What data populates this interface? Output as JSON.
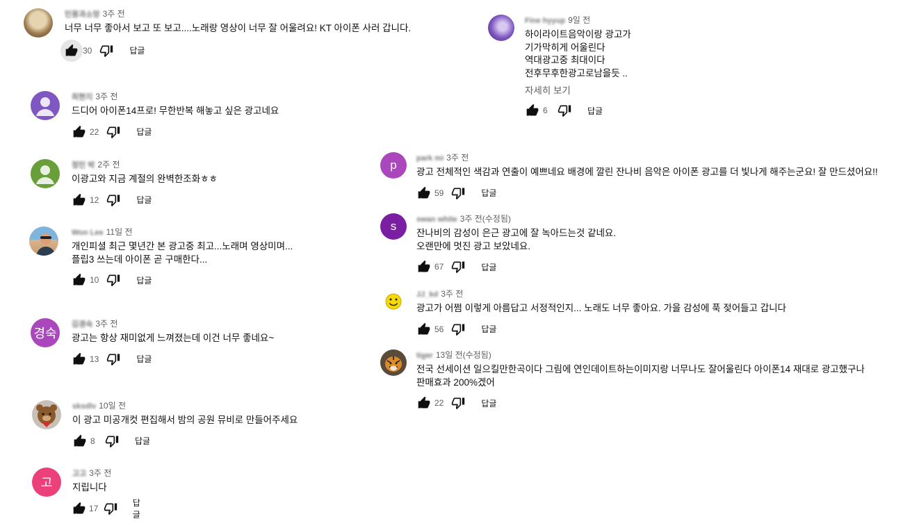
{
  "labels": {
    "reply": "답글",
    "show_more": "자세히 보기"
  },
  "left": [
    {
      "author": "민몽과소망",
      "time": "3주 전",
      "lines": [
        "너무 너무 좋아서 보고 또 보고....노래랑 영상이 너무 잘 어울려요! KT 아이폰 사러 갑니다."
      ],
      "likes": "30",
      "avatar": {
        "type": "photo",
        "color": "#b69c74"
      }
    },
    {
      "author": "최현지",
      "time": "3주 전",
      "lines": [
        "드디어 아이폰14프로! 무한반복 해놓고 싶은 광고네요"
      ],
      "likes": "22",
      "avatar": {
        "type": "default",
        "color": "#7e57c2"
      }
    },
    {
      "author": "정민 박",
      "time": "2주 전",
      "lines": [
        "이광고와 지금 계절의 완벽한조화ㅎㅎ"
      ],
      "likes": "12",
      "avatar": {
        "type": "default",
        "color": "#689f38"
      }
    },
    {
      "author": "Won Lee",
      "time": "11일 전",
      "lines": [
        "개인피셜 최근 몇년간 본 광고중 최고...노래며 영상미며...",
        "플립3 쓰는데 아이폰 곧 구매한다..."
      ],
      "likes": "10",
      "avatar": {
        "type": "photo",
        "color": "#5d8fb5"
      }
    },
    {
      "author": "김경숙",
      "time": "3주 전",
      "lines": [
        "광고는 항상 재미없게 느껴졌는데 이건 너무 좋네요~"
      ],
      "likes": "13",
      "avatar": {
        "type": "letter",
        "letter": "경숙",
        "color": "#ab47bc"
      }
    },
    {
      "author": "sksdlv",
      "time": "10일 전",
      "lines": [
        "이 광고 미공개컷 편집해서 밤의 공원 뮤비로 만들어주세요"
      ],
      "likes": "8",
      "avatar": {
        "type": "photo",
        "color": "#a0522d"
      }
    },
    {
      "author": "고고",
      "time": "3주 전",
      "lines": [
        "지립니다"
      ],
      "likes": "17",
      "avatar": {
        "type": "letter",
        "letter": "고",
        "color": "#ec407a"
      }
    }
  ],
  "right": [
    {
      "author": "Fine hyyup",
      "time": "9일 전",
      "lines": [
        "하이라이트음악이랑 광고가",
        "기가막히게  어울린다",
        "역대광고중 최대이다",
        "전후무후한광고로남을듯 .."
      ],
      "show_more": true,
      "likes": "6",
      "avatar": {
        "type": "photo",
        "color": "#6a4f9c"
      }
    },
    {
      "author": "park mi",
      "time": "3주 전",
      "lines": [
        "광고 전체적인 색감과 연출이 예쁘네요 배경에 깔린 잔나비 음악은 아이폰 광고를 더 빛나게 해주는군요! 잘 만드셨어요!!"
      ],
      "likes": "59",
      "avatar": {
        "type": "letter",
        "letter": "p",
        "color": "#ab47bc"
      }
    },
    {
      "author": "swan white",
      "time": "3주 전(수정됨)",
      "lines": [
        "잔나비의 감성이 은근 광고에 잘 녹아드는것 같네요.",
        "오랜만에 멋진 광고 보았네요."
      ],
      "likes": "67",
      "avatar": {
        "type": "letter",
        "letter": "s",
        "color": "#7b1fa2"
      }
    },
    {
      "author": "JJ_kd",
      "time": "3주 전",
      "lines": [
        "광고가 어쩜 이렇게 아름답고 서정적인지... 노래도 너무 좋아요. 가을 감성에 푹 젖어들고 갑니다"
      ],
      "likes": "56",
      "avatar": {
        "type": "smiley",
        "color": "#f5d90a"
      }
    },
    {
      "author": "tiger",
      "time": "13일 전(수정됨)",
      "lines": [
        "전국 선세이션 일으킬만한곡이다 그림에 연인데이트하는이미지랑 너무나도 잘어울린다 아이폰14 재대로 광고했구나",
        "판매효과 200%겠어"
      ],
      "likes": "22",
      "avatar": {
        "type": "photo",
        "color": "#8a6a3c"
      }
    }
  ]
}
